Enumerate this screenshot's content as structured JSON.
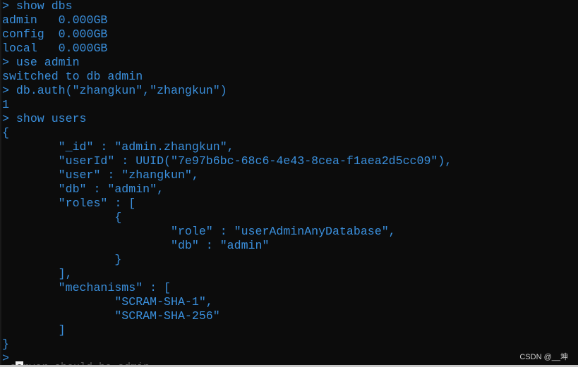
{
  "terminal": {
    "lines": [
      "> show dbs",
      "admin   0.000GB",
      "config  0.000GB",
      "local   0.000GB",
      "> use admin",
      "switched to db admin",
      "> db.auth(\"zhangkun\",\"zhangkun\")",
      "1",
      "> show users",
      "{",
      "        \"_id\" : \"admin.zhangkun\",",
      "        \"userId\" : UUID(\"7e97b6bc-68c6-4e43-8cea-f1aea2d5cc09\"),",
      "        \"user\" : \"zhangkun\",",
      "        \"db\" : \"admin\",",
      "        \"roles\" : [",
      "                {",
      "                        \"role\" : \"userAdminAnyDatabase\",",
      "                        \"db\" : \"admin\"",
      "                }",
      "        ],",
      "        \"mechanisms\" : [",
      "                \"SCRAM-SHA-1\",",
      "                \"SCRAM-SHA-256\"",
      "        ]",
      "}",
      ">"
    ],
    "partial_line": "server should be admin..."
  },
  "watermark": "CSDN @__坤",
  "colors": {
    "background": "#0c0c0c",
    "text": "#3a8fdc"
  }
}
